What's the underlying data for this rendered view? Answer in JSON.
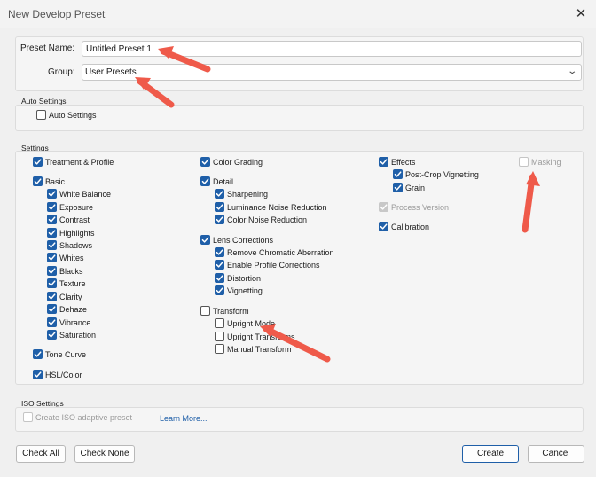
{
  "window": {
    "title": "New Develop Preset"
  },
  "preset": {
    "name_label": "Preset Name:",
    "name_value": "Untitled Preset 1",
    "group_label": "Group:",
    "group_value": "User Presets"
  },
  "auto_settings": {
    "title": "Auto Settings",
    "items": [
      {
        "label": "Auto Settings",
        "checked": false
      }
    ]
  },
  "settings": {
    "title": "Settings",
    "col1": {
      "treatment": {
        "label": "Treatment & Profile",
        "checked": true
      },
      "basic": {
        "label": "Basic",
        "checked": true
      },
      "basic_items": [
        {
          "label": "White Balance",
          "checked": true
        },
        {
          "label": "Exposure",
          "checked": true
        },
        {
          "label": "Contrast",
          "checked": true
        },
        {
          "label": "Highlights",
          "checked": true
        },
        {
          "label": "Shadows",
          "checked": true
        },
        {
          "label": "Whites",
          "checked": true
        },
        {
          "label": "Blacks",
          "checked": true
        },
        {
          "label": "Texture",
          "checked": true
        },
        {
          "label": "Clarity",
          "checked": true
        },
        {
          "label": "Dehaze",
          "checked": true
        },
        {
          "label": "Vibrance",
          "checked": true
        },
        {
          "label": "Saturation",
          "checked": true
        }
      ],
      "tone_curve": {
        "label": "Tone Curve",
        "checked": true
      },
      "hsl": {
        "label": "HSL/Color",
        "checked": true
      }
    },
    "col2": {
      "color_grading": {
        "label": "Color Grading",
        "checked": true
      },
      "detail": {
        "label": "Detail",
        "checked": true
      },
      "detail_items": [
        {
          "label": "Sharpening",
          "checked": true
        },
        {
          "label": "Luminance Noise Reduction",
          "checked": true
        },
        {
          "label": "Color Noise Reduction",
          "checked": true
        }
      ],
      "lens": {
        "label": "Lens Corrections",
        "checked": true
      },
      "lens_items": [
        {
          "label": "Remove Chromatic Aberration",
          "checked": true
        },
        {
          "label": "Enable Profile Corrections",
          "checked": true
        },
        {
          "label": "Distortion",
          "checked": true
        },
        {
          "label": "Vignetting",
          "checked": true
        }
      ],
      "transform": {
        "label": "Transform",
        "checked": false
      },
      "transform_items": [
        {
          "label": "Upright Mode",
          "checked": false
        },
        {
          "label": "Upright Transforms",
          "checked": false
        },
        {
          "label": "Manual Transform",
          "checked": false
        }
      ]
    },
    "col3": {
      "effects": {
        "label": "Effects",
        "checked": true
      },
      "effects_items": [
        {
          "label": "Post-Crop Vignetting",
          "checked": true
        },
        {
          "label": "Grain",
          "checked": true
        }
      ],
      "process_version": {
        "label": "Process Version",
        "checked": true,
        "disabled": true
      },
      "calibration": {
        "label": "Calibration",
        "checked": true
      }
    },
    "col4": {
      "masking": {
        "label": "Masking",
        "checked": false,
        "disabled": true
      }
    }
  },
  "iso": {
    "title": "ISO Settings",
    "checkbox_label": "Create ISO adaptive preset",
    "link": "Learn More..."
  },
  "buttons": {
    "check_all": "Check All",
    "check_none": "Check None",
    "create": "Create",
    "cancel": "Cancel"
  },
  "colors": {
    "accent": "#1f5fa8",
    "annotation_arrow": "#ef5a4a"
  }
}
